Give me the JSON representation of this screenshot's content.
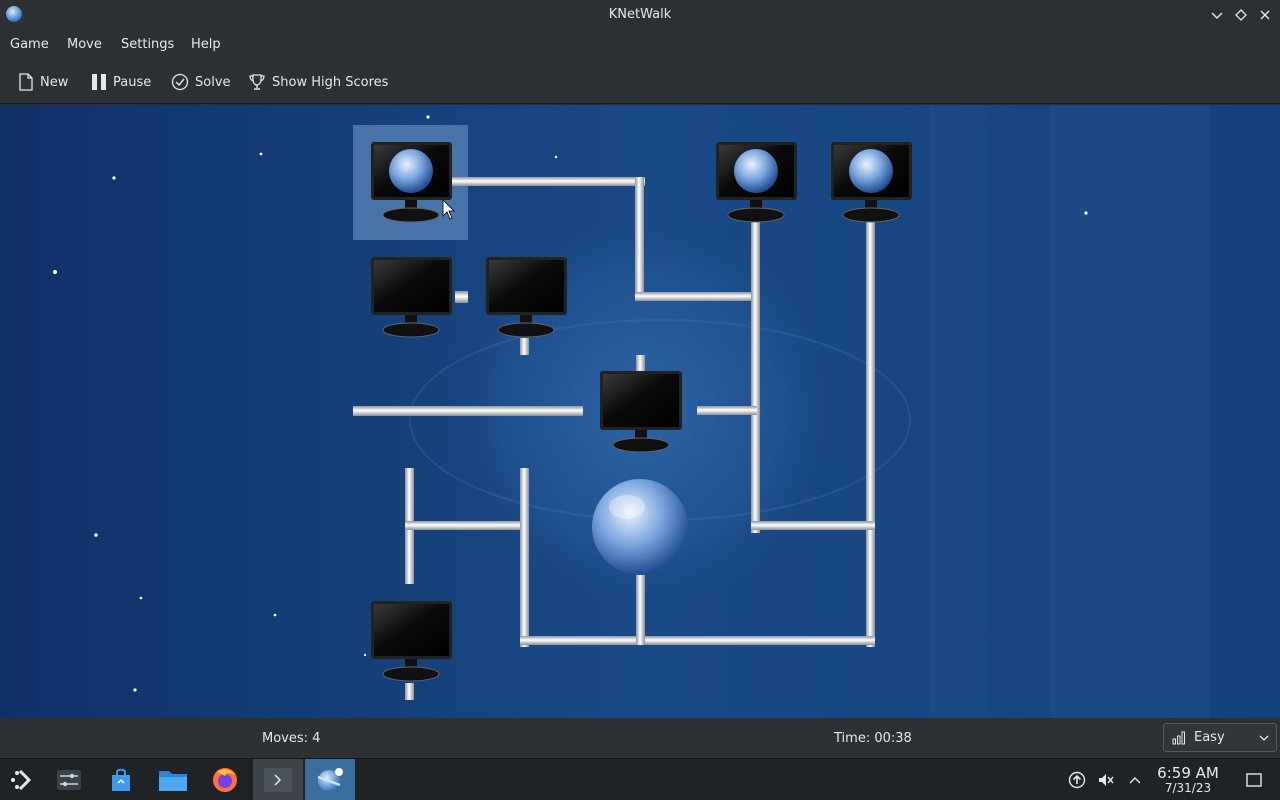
{
  "window": {
    "title": "KNetWalk"
  },
  "menu": {
    "items": [
      "Game",
      "Move",
      "Settings",
      "Help"
    ]
  },
  "toolbar": {
    "new": "New",
    "pause": "Pause",
    "solve": "Solve",
    "high_scores": "Show High Scores"
  },
  "status": {
    "moves": "Moves: 4",
    "time": "Time: 00:38",
    "difficulty": "Easy"
  },
  "taskbar": {
    "clock_time": "6:59 AM",
    "clock_date": "7/31/23"
  },
  "colors": {
    "background": "#123b74",
    "chrome": "#2d3136",
    "taskbar": "#202326",
    "selection": "#5a86b8"
  }
}
